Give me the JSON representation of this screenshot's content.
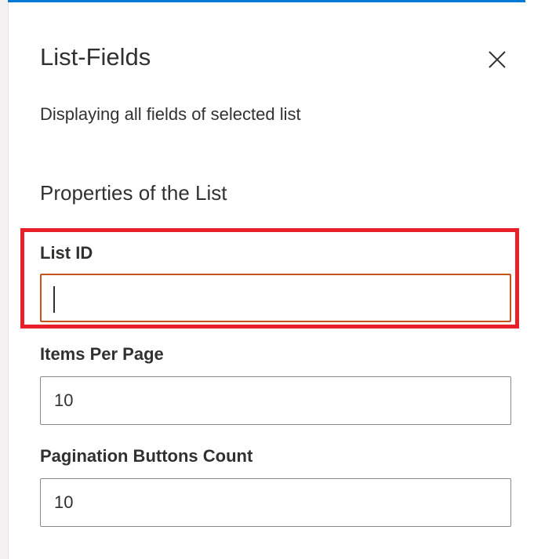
{
  "panel": {
    "title": "List-Fields",
    "close_icon": "close-icon",
    "description": "Displaying all fields of selected list",
    "group_title": "Properties of the List"
  },
  "fields": {
    "list_id": {
      "label": "List ID",
      "value": "",
      "focused": true
    },
    "items_per_page": {
      "label": "Items Per Page",
      "value": "10"
    },
    "pagination_buttons_count": {
      "label": "Pagination Buttons Count",
      "value": "10"
    }
  },
  "colors": {
    "accent": "#0078d4",
    "highlight": "#e8202a",
    "focus_border": "#c8541a",
    "text": "#323130",
    "input_border": "#8a8886"
  }
}
